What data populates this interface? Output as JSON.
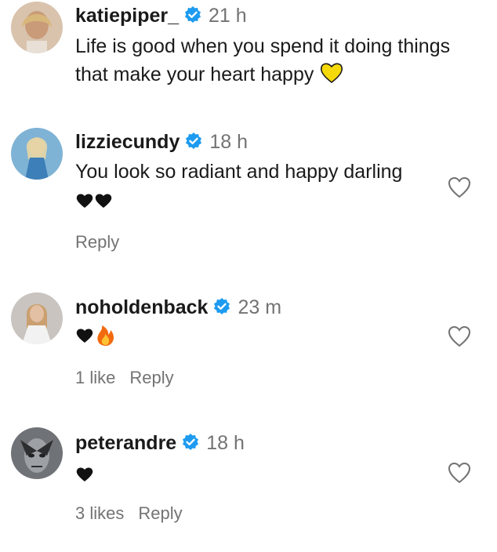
{
  "comments": [
    {
      "username": "katiepiper_",
      "time": "21 h",
      "text": "Life is good when you spend it doing things that make your heart happy",
      "emoji": "yellow-heart"
    },
    {
      "username": "lizziecundy",
      "time": "18 h",
      "text": "You look so radiant and happy darling",
      "emoji": "black-hearts",
      "reply_label": "Reply"
    },
    {
      "username": "noholdenback",
      "time": "23 m",
      "emoji": "black-heart-fire",
      "likes_label": "1 like",
      "reply_label": "Reply"
    },
    {
      "username": "peterandre",
      "time": "18 h",
      "emoji": "black-heart",
      "likes_label": "3 likes",
      "reply_label": "Reply"
    }
  ],
  "colors": {
    "verified": "#1d9bf0",
    "muted_text": "#737373",
    "yellow_heart": "#f5d90a",
    "fire": "#f26a10"
  }
}
